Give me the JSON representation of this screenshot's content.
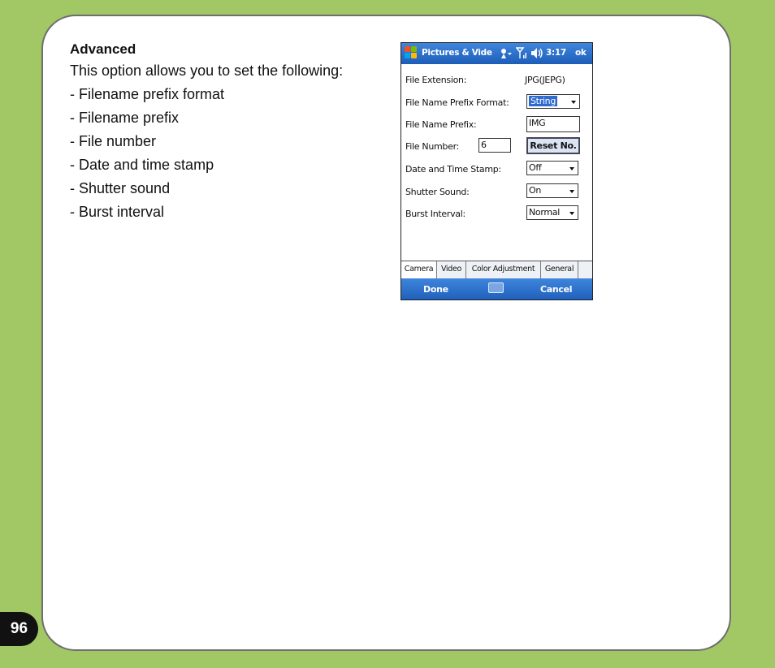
{
  "doc": {
    "heading": "Advanced",
    "intro": "This option allows you to set the following:",
    "items": [
      "- Filename prefix format",
      "- Filename prefix",
      "- File number",
      "- Date and time stamp",
      "- Shutter sound",
      "- Burst interval"
    ],
    "page_number": "96"
  },
  "device": {
    "title": "Pictures & Vide",
    "clock": "3:17",
    "ok_label": "ok",
    "form": {
      "file_extension_label": "File Extension:",
      "file_extension_value": "JPG(JEPG)",
      "prefix_format_label": "File Name Prefix Format:",
      "prefix_format_value": "String",
      "prefix_label": "File Name Prefix:",
      "prefix_value": "IMG",
      "file_number_label": "File Number:",
      "file_number_value": "6",
      "reset_label": "Reset No.",
      "date_stamp_label": "Date and Time Stamp:",
      "date_stamp_value": "Off",
      "shutter_label": "Shutter Sound:",
      "shutter_value": "On",
      "burst_label": "Burst Interval:",
      "burst_value": "Normal"
    },
    "tabs": [
      "Camera",
      "Video",
      "Color Adjustment",
      "General"
    ],
    "softkeys": {
      "left": "Done",
      "right": "Cancel"
    }
  },
  "colors": {
    "page_background": "#a2c865",
    "titlebar_blue": "#1d5db9",
    "selection_blue": "#2f6ad0"
  }
}
